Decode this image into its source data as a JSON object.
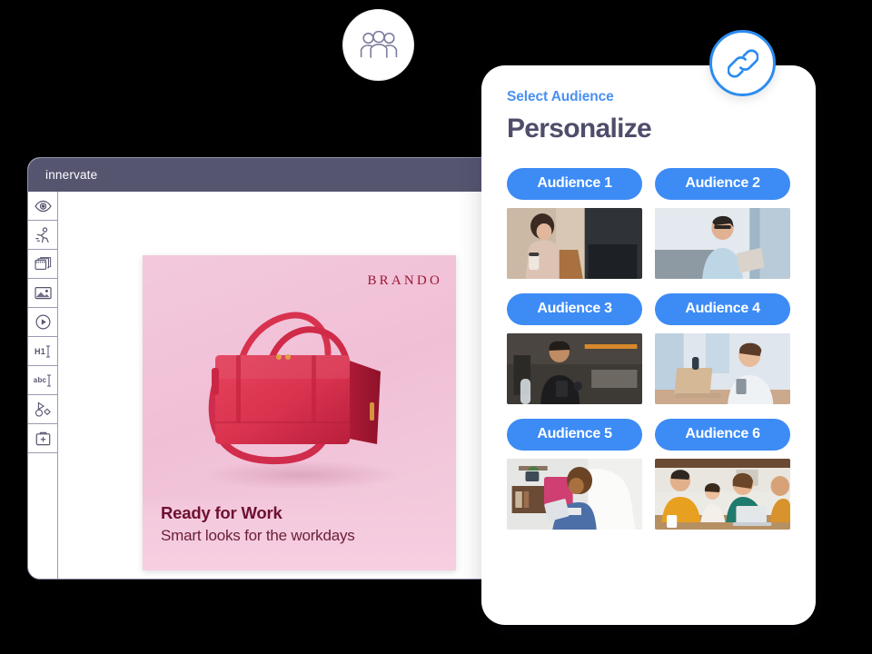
{
  "editor": {
    "title": "innervate",
    "toolbar": [
      {
        "name": "preview-eye-icon",
        "icon": "eye",
        "label": ""
      },
      {
        "name": "animation-runner-icon",
        "icon": "runner",
        "label": ""
      },
      {
        "name": "slides-icon",
        "icon": "slides",
        "label": ""
      },
      {
        "name": "image-icon",
        "icon": "image",
        "label": ""
      },
      {
        "name": "video-play-icon",
        "icon": "play",
        "label": ""
      },
      {
        "name": "heading-text-icon",
        "icon": "text",
        "label": "H1"
      },
      {
        "name": "body-text-icon",
        "icon": "text",
        "label": "abc"
      },
      {
        "name": "shapes-icon",
        "icon": "shapes",
        "label": ""
      },
      {
        "name": "add-element-icon",
        "icon": "plus-box",
        "label": ""
      }
    ]
  },
  "creative": {
    "brand": "BRANDO",
    "headline": "Ready for Work",
    "subhead": "Smart looks for the workdays",
    "product": "red leather handbag",
    "background_color": "#f1c4da"
  },
  "panel": {
    "eyebrow": "Select Audience",
    "title": "Personalize",
    "accent_color": "#3d8bf5",
    "audiences": [
      {
        "label": "Audience 1",
        "thumb": "woman in car with coffee and laptop"
      },
      {
        "label": "Audience 2",
        "thumb": "man outdoors with tablet"
      },
      {
        "label": "Audience 3",
        "thumb": "man at gym with phone"
      },
      {
        "label": "Audience 4",
        "thumb": "woman at desk with laptop"
      },
      {
        "label": "Audience 5",
        "thumb": "child on couch with tablet"
      },
      {
        "label": "Audience 6",
        "thumb": "family in kitchen with laptop"
      }
    ]
  },
  "badges": {
    "people": "people-group-icon",
    "link": "link-chain-icon"
  }
}
